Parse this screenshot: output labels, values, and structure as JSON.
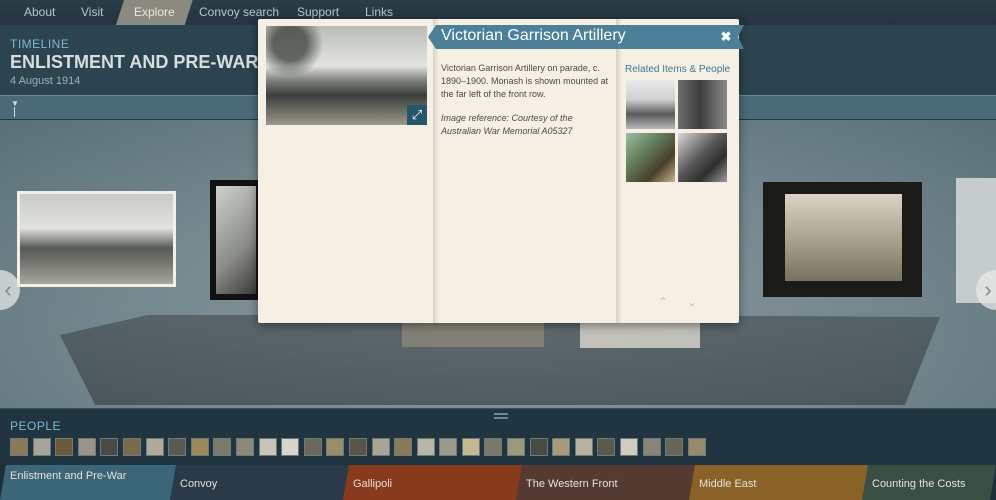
{
  "nav": {
    "items": [
      "About",
      "Visit",
      "Explore",
      "Convoy search",
      "Support",
      "Links"
    ],
    "active": "Explore"
  },
  "timeline": {
    "label": "TIMELINE",
    "title": "ENLISTMENT AND PRE-WAR",
    "date": "4 August 1914"
  },
  "modal": {
    "title": "Victorian Garrison Artillery",
    "description": "Victorian Garrison Artillery on parade, c. 1890–1900. Monash is shown mounted at the far left of the front row.",
    "credit": "Image reference: Courtesy of the Australian War Memorial A05327",
    "related_title": "Related Items & People",
    "close_icon": "close-icon",
    "expand_icon": "expand-icon"
  },
  "people": {
    "label": "PEOPLE"
  },
  "eras": [
    {
      "label": "Enlistment and Pre-War",
      "color": "#3a6678"
    },
    {
      "label": "Convoy",
      "color": "#2a3a48"
    },
    {
      "label": "Gallipoli",
      "color": "#8a3a1c"
    },
    {
      "label": "The Western Front",
      "color": "#553a32"
    },
    {
      "label": "Middle East",
      "color": "#8a6228"
    },
    {
      "label": "Counting the Costs",
      "color": "#3a4f44"
    }
  ],
  "colors": {
    "accent": "#4b8098",
    "nav_active": "#8a8a80",
    "modal_bg": "#f6efe3"
  }
}
